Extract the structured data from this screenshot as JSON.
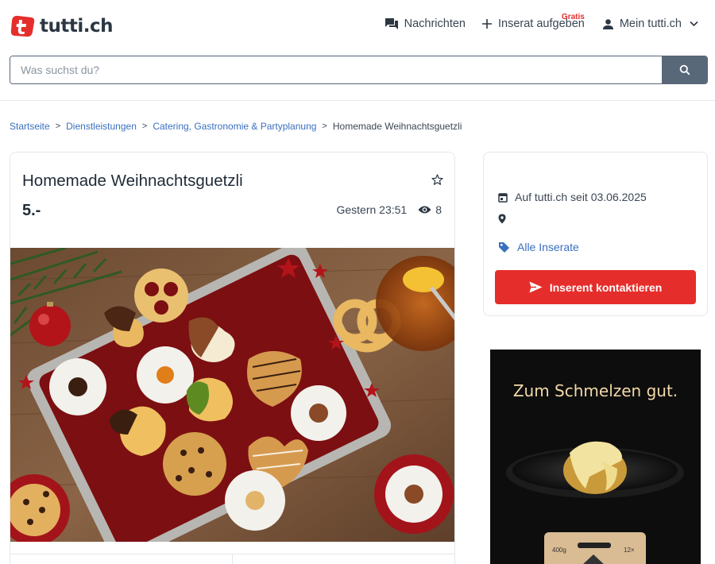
{
  "brand": {
    "name": "tutti.ch",
    "accent": "#e52e2b"
  },
  "nav": {
    "messages": "Nachrichten",
    "insert": "Inserat aufgeben",
    "insert_badge": "Gratis",
    "account": "Mein tutti.ch"
  },
  "search": {
    "placeholder": "Was suchst du?",
    "icon": "search-icon"
  },
  "breadcrumb": {
    "items": [
      "Startseite",
      "Dienstleistungen",
      "Catering, Gastronomie & Partyplanung"
    ],
    "current": "Homemade Weihnachtsguetzli"
  },
  "listing": {
    "title": "Homemade Weihnachtsguetzli",
    "price": "5.-",
    "posted": "Gestern 23:51",
    "views": "8"
  },
  "seller": {
    "member_since": "Auf tutti.ch seit 03.06.2025",
    "all_listings": "Alle Inserate",
    "contact": "Inserent kontaktieren"
  },
  "ad": {
    "headline": "Zum Schmelzen gut.",
    "tag_weight": "400g",
    "tag_count": "12×"
  }
}
